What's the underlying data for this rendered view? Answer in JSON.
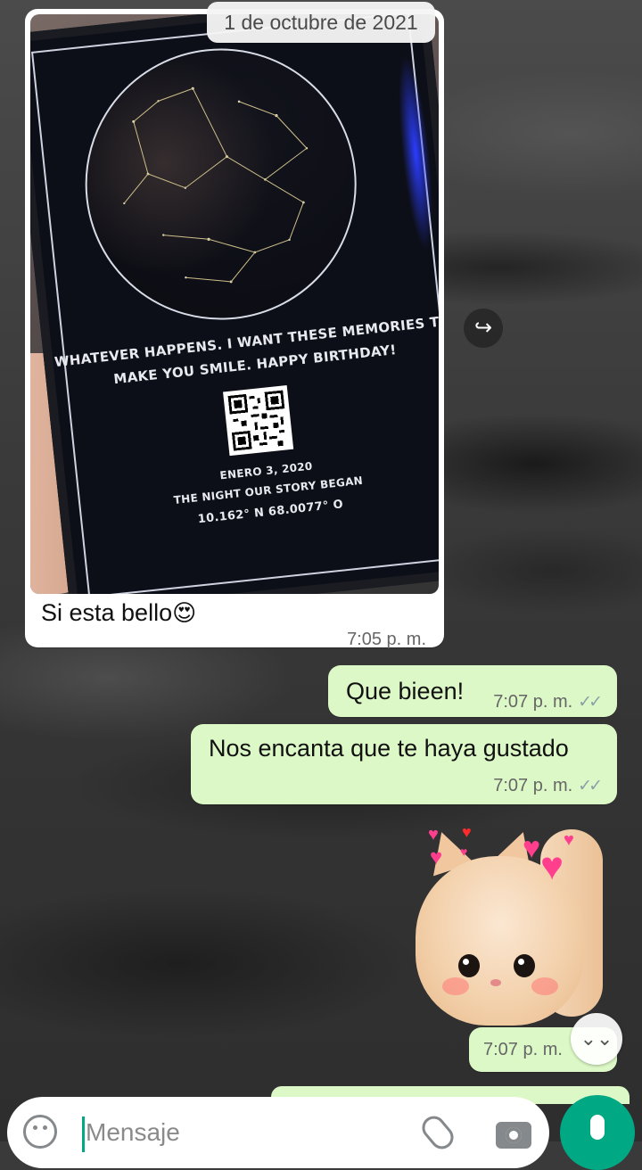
{
  "chat": {
    "date_chip": "1 de octubre de 2021",
    "incoming_image": {
      "frame_line1": "WHATEVER HAPPENS. I WANT THESE MEMORIES TO",
      "frame_line2": "MAKE YOU SMILE. HAPPY BIRTHDAY!",
      "frame_date": "ENERO 3, 2020",
      "frame_subtitle": "THE NIGHT OUR STORY BEGAN",
      "frame_coords": "10.162° N 68.0077° O",
      "caption": "Si esta bello",
      "caption_emoji": "😍",
      "time": "7:05 p. m."
    },
    "outgoing": [
      {
        "text": "Que bieen!",
        "time": "7:07 p. m.",
        "status": "✓✓"
      },
      {
        "text": "Nos encanta que te haya gustado",
        "time": "7:07 p. m.",
        "status": "✓✓"
      }
    ],
    "sticker": {
      "icon": "cat-hearts-sticker",
      "time": "7:07 p. m."
    },
    "forward_icon": "↪",
    "scroll_down_icon": "⌄⌄"
  },
  "composer": {
    "placeholder": "Mensaje",
    "icons": {
      "emoji": "emoji-icon",
      "attach": "paperclip-icon",
      "camera": "camera-icon",
      "mic": "mic-icon"
    }
  },
  "colors": {
    "outgoing_bubble": "#dcf8c6",
    "incoming_bubble": "#ffffff",
    "accent": "#00a884"
  }
}
